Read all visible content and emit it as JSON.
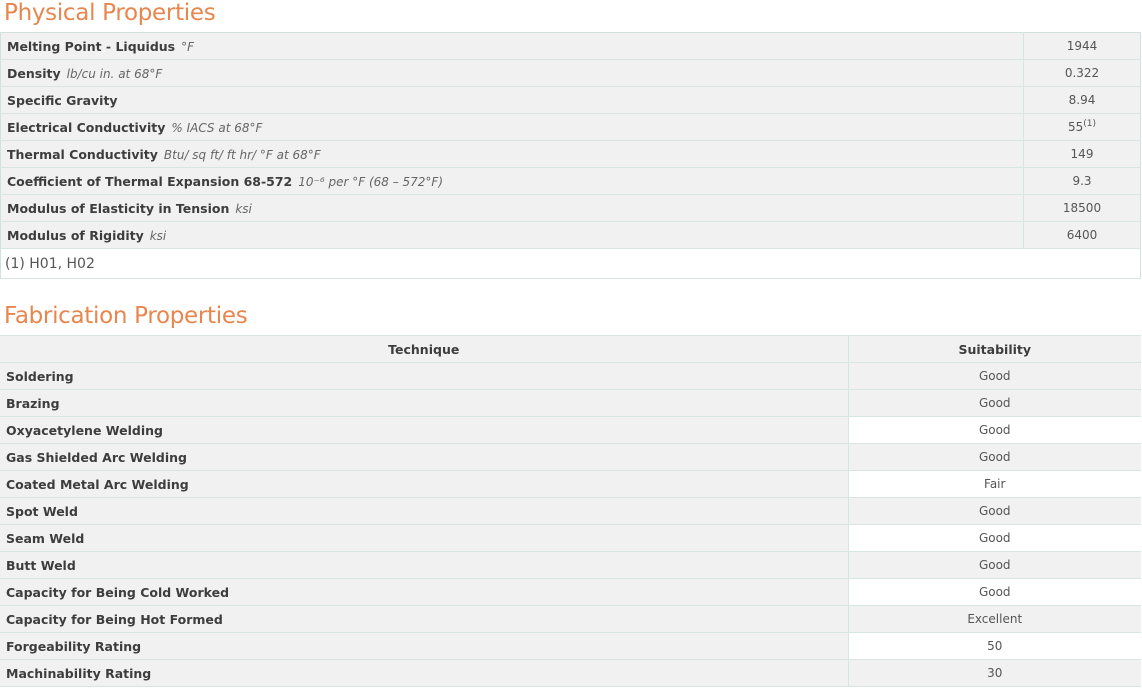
{
  "physical": {
    "title": "Physical Properties",
    "rows": [
      {
        "label": "Melting Point - Liquidus",
        "unit": "°F",
        "value": "1944",
        "sup": ""
      },
      {
        "label": "Density",
        "unit": "lb/cu in. at 68°F",
        "value": "0.322",
        "sup": ""
      },
      {
        "label": "Specific Gravity",
        "unit": "",
        "value": "8.94",
        "sup": ""
      },
      {
        "label": "Electrical Conductivity",
        "unit": "% IACS at 68°F",
        "value": "55",
        "sup": "(1)"
      },
      {
        "label": "Thermal Conductivity",
        "unit": "Btu/ sq ft/ ft hr/ °F at 68°F",
        "value": "149",
        "sup": ""
      },
      {
        "label": "Coefficient of Thermal Expansion 68-572",
        "unit": "10⁻⁶ per °F (68 – 572°F)",
        "value": "9.3",
        "sup": ""
      },
      {
        "label": "Modulus of Elasticity in Tension",
        "unit": "ksi",
        "value": "18500",
        "sup": ""
      },
      {
        "label": "Modulus of Rigidity",
        "unit": "ksi",
        "value": "6400",
        "sup": ""
      }
    ],
    "footnote": "(1) H01, H02"
  },
  "fabrication": {
    "title": "Fabrication Properties",
    "headers": {
      "technique": "Technique",
      "suitability": "Suitability"
    },
    "rows": [
      {
        "technique": "Soldering",
        "suitability": "Good"
      },
      {
        "technique": "Brazing",
        "suitability": "Good"
      },
      {
        "technique": "Oxyacetylene Welding",
        "suitability": "Good"
      },
      {
        "technique": "Gas Shielded Arc Welding",
        "suitability": "Good"
      },
      {
        "technique": "Coated Metal Arc Welding",
        "suitability": "Fair"
      },
      {
        "technique": "Spot Weld",
        "suitability": "Good"
      },
      {
        "technique": "Seam Weld",
        "suitability": "Good"
      },
      {
        "technique": "Butt Weld",
        "suitability": "Good"
      },
      {
        "technique": "Capacity for Being Cold Worked",
        "suitability": "Good"
      },
      {
        "technique": "Capacity for Being Hot Formed",
        "suitability": "Excellent"
      },
      {
        "technique": "Forgeability Rating",
        "suitability": "50"
      },
      {
        "technique": "Machinability Rating",
        "suitability": "30"
      }
    ]
  }
}
